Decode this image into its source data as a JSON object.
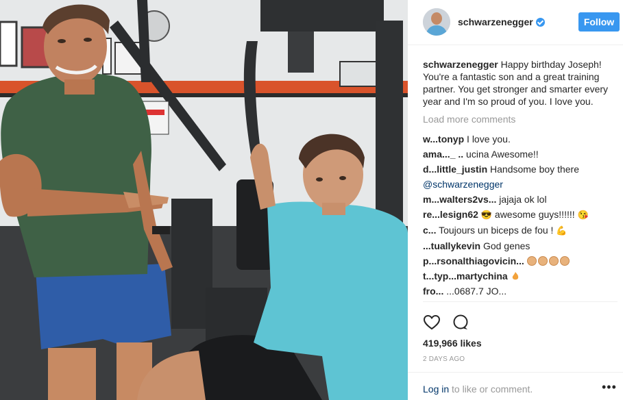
{
  "post": {
    "username": "schwarzenegger",
    "follow_label": "Follow",
    "caption_user": "schwarzenegger",
    "caption_text": "Happy birthday Joseph! You're a fantastic son and a great training partner. You get stronger and smarter every year and I'm so proud of you. I love you.",
    "load_more": "Load more comments",
    "likes": "419,966 likes",
    "time": "2 DAYS AGO",
    "login_link": "Log in",
    "login_rest": " to like or comment.",
    "more": "•••"
  },
  "comments": [
    {
      "handle": "w...tonyp",
      "text": "I love you."
    },
    {
      "handle": "ama..._ ..",
      "text": "ucina Awesome!!"
    },
    {
      "handle": "d...little_justin",
      "text": "Handsome boy there"
    },
    {
      "handle": "",
      "text": "",
      "mention": "@schwarzenegger"
    },
    {
      "handle": "m...walters2vs...",
      "text": "jajaja ok lol"
    },
    {
      "handle": "re...lesign62",
      "text": "awesome guys!!!!!!"
    },
    {
      "handle": "c...",
      "text": "Toujours un biceps de fou !"
    },
    {
      "handle": "...tuallykevin",
      "text": "God genes"
    },
    {
      "handle": "p...rsonalthiagovicin...",
      "text": ""
    },
    {
      "handle": "t...typ...martychina",
      "text": ""
    },
    {
      "handle": "fro...",
      "text": "...0687.7 JO..."
    }
  ],
  "icons": {
    "heart": "heart-icon",
    "comment": "comment-icon",
    "verified": "verified-badge-icon"
  },
  "colors": {
    "accent": "#3897f0",
    "link": "#003569",
    "muted": "#999999"
  }
}
